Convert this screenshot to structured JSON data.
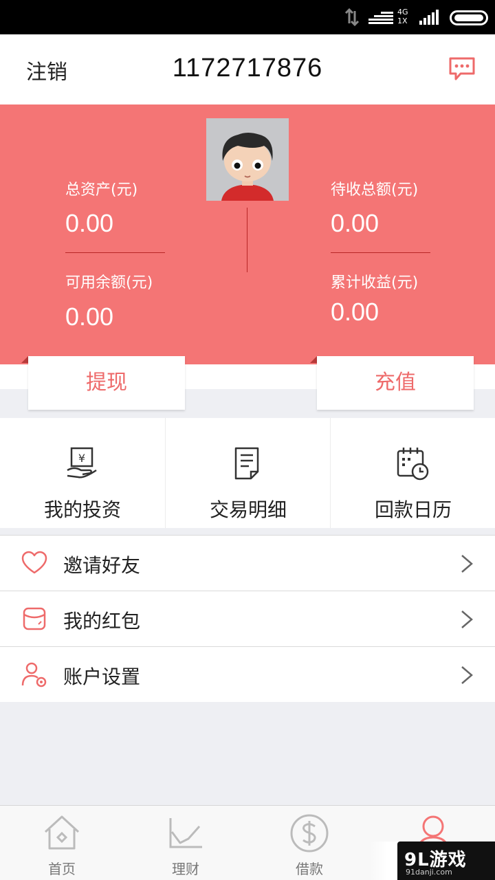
{
  "statusbar": {
    "network_label": "4G\n1X"
  },
  "header": {
    "logout_label": "注销",
    "account_number": "1172717876"
  },
  "assets": {
    "total_assets_label": "总资产(元)",
    "total_assets_value": "0.00",
    "available_balance_label": "可用余额(元)",
    "available_balance_value": "0.00",
    "pending_total_label": "待收总额(元)",
    "pending_total_value": "0.00",
    "cumulative_income_label": "累计收益(元)",
    "cumulative_income_value": "0.00"
  },
  "actions": {
    "withdraw_label": "提现",
    "recharge_label": "充值"
  },
  "grid": [
    {
      "label": "我的投资",
      "icon": "investment-icon"
    },
    {
      "label": "交易明细",
      "icon": "transaction-detail-icon"
    },
    {
      "label": "回款日历",
      "icon": "repayment-calendar-icon"
    }
  ],
  "list": [
    {
      "label": "邀请好友",
      "icon": "heart-icon"
    },
    {
      "label": "我的红包",
      "icon": "red-packet-icon"
    },
    {
      "label": "账户设置",
      "icon": "user-settings-icon"
    }
  ],
  "bottom_nav": [
    {
      "label": "首页",
      "icon": "home-icon"
    },
    {
      "label": "理财",
      "icon": "chart-icon"
    },
    {
      "label": "借款",
      "icon": "dollar-icon"
    },
    {
      "label": "",
      "icon": "user-icon",
      "active": true
    }
  ],
  "watermark": {
    "text": "9L游戏",
    "sub": "91danji.com"
  },
  "colors": {
    "accent": "#f47575",
    "accent_text": "#ee6a6a",
    "divider": "#b82626"
  }
}
